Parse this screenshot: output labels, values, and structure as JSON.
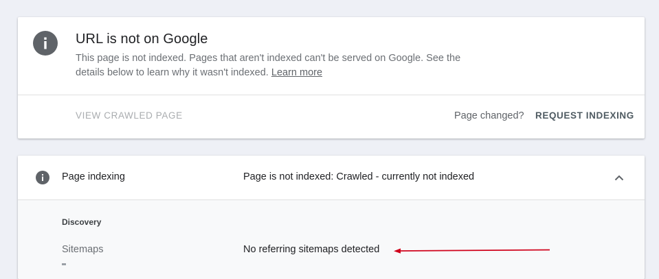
{
  "status_card": {
    "title": "URL is not on Google",
    "description": "This page is not indexed. Pages that aren't indexed can't be served on Google. See the details below to learn why it wasn't indexed.",
    "learn_more": "Learn more",
    "view_crawled_label": "VIEW CRAWLED PAGE",
    "page_changed_label": "Page changed?",
    "request_indexing_label": "REQUEST INDEXING",
    "icon": "info-icon"
  },
  "indexing_card": {
    "label": "Page indexing",
    "status": "Page is not indexed: Crawled - currently not indexed",
    "icon": "info-icon",
    "toggle_icon": "chevron-up-icon",
    "section_heading": "Discovery",
    "rows": [
      {
        "label": "Sitemaps",
        "value": "No referring sitemaps detected"
      }
    ]
  },
  "colors": {
    "background": "#eef0f6",
    "card": "#ffffff",
    "icon_gray": "#5f6368",
    "annotation_red": "#d0021b"
  }
}
